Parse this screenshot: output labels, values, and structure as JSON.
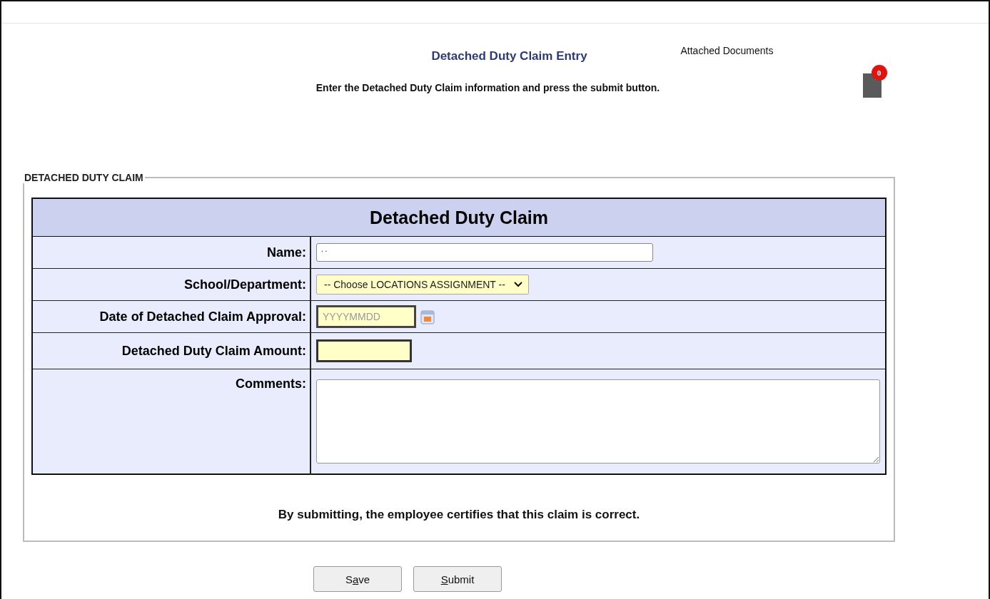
{
  "header": {
    "title": "Detached Duty Claim Entry",
    "attachments_label": "Attached Documents",
    "attachment_count": "0"
  },
  "instruction": "Enter the Detached Duty Claim information and press the submit button.",
  "fieldset": {
    "legend": "DETACHED DUTY CLAIM",
    "table": {
      "title": "Detached Duty Claim",
      "rows": [
        {
          "kind": "text",
          "label": "Name:",
          "value": ". ."
        },
        {
          "kind": "select",
          "label": "School/Department:",
          "value": "-- Choose LOCATIONS ASSIGNMENT --"
        },
        {
          "kind": "date",
          "label": "Date of Detached Claim Approval:",
          "placeholder": "YYYYMMDD"
        },
        {
          "kind": "amount",
          "label": "Detached Duty Claim Amount:"
        },
        {
          "kind": "textarea",
          "label": "Comments:"
        }
      ]
    },
    "certification": "By submitting, the employee certifies that this claim is correct."
  },
  "buttons": [
    {
      "label_parts": [
        {
          "text": "S",
          "underlined": false
        },
        {
          "text": "a",
          "underlined": true
        },
        {
          "text": "ve",
          "underlined": false
        }
      ]
    },
    {
      "label_parts": [
        {
          "text": "S",
          "underlined": true
        },
        {
          "text": "ubmit",
          "underlined": false
        }
      ]
    }
  ]
}
